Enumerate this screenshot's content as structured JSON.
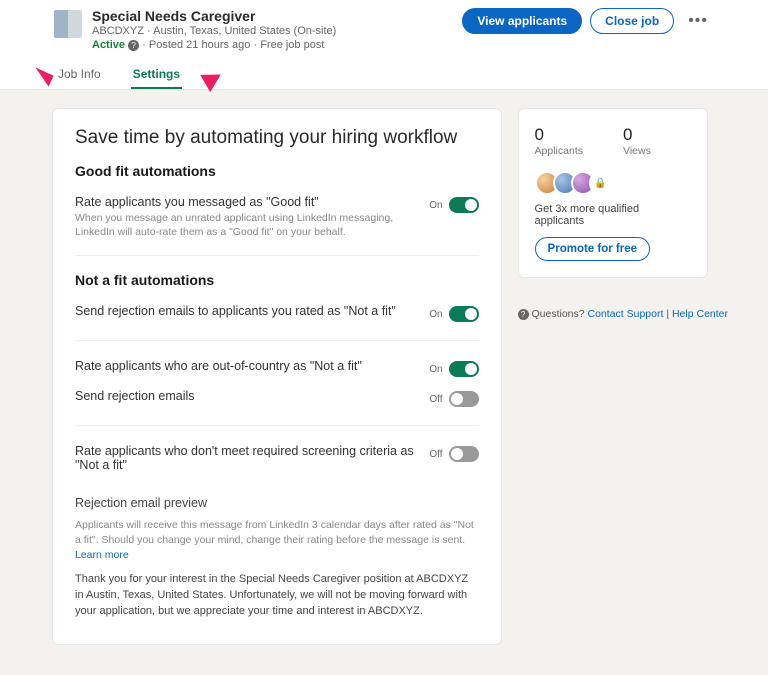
{
  "header": {
    "title": "Special Needs Caregiver",
    "subtitle": "ABCDXYZ · Austin, Texas, United States (On-site)",
    "status": "Active",
    "posted": "Posted 21 hours ago",
    "type": "Free job post",
    "view_applicants": "View applicants",
    "close_job": "Close job"
  },
  "tabs": {
    "job_info": "Job Info",
    "settings": "Settings"
  },
  "save_title": "Save time by automating your hiring workflow",
  "good_fit": {
    "heading": "Good fit automations",
    "rate": {
      "title": "Rate applicants you messaged as \"Good fit\"",
      "sub": "When you message an unrated applicant using LinkedIn messaging, LinkedIn will auto-rate them as a \"Good fit\" on your behalf.",
      "label": "On"
    }
  },
  "not_fit": {
    "heading": "Not a fit automations",
    "send_rej": {
      "title": "Send rejection emails to applicants you rated as \"Not a fit\"",
      "label": "On"
    },
    "out_country": {
      "title": "Rate applicants who are out-of-country as \"Not a fit\"",
      "label": "On"
    },
    "send_rej2": {
      "title": "Send rejection emails",
      "label": "Off"
    },
    "screening": {
      "title": "Rate applicants who don't meet required screening criteria as \"Not a fit\"",
      "label": "Off"
    }
  },
  "rejection": {
    "heading": "Rejection email preview",
    "note": "Applicants will receive this message from LinkedIn 3 calendar days after rated as \"Not a fit\". Should you change your mind, change their rating before the message is sent.",
    "learn_more": "Learn more",
    "body": "Thank you for your interest in the Special Needs Caregiver position at ABCDXYZ in Austin, Texas, United States. Unfortunately, we will not be moving forward with your application, but we appreciate your time and interest in ABCDXYZ."
  },
  "side": {
    "applicants_n": "0",
    "applicants_l": "Applicants",
    "views_n": "0",
    "views_l": "Views",
    "promo_text": "Get 3x more qualified applicants",
    "promote": "Promote for free",
    "q": "Questions?",
    "contact": "Contact Support",
    "sep": " | ",
    "help": "Help Center"
  }
}
